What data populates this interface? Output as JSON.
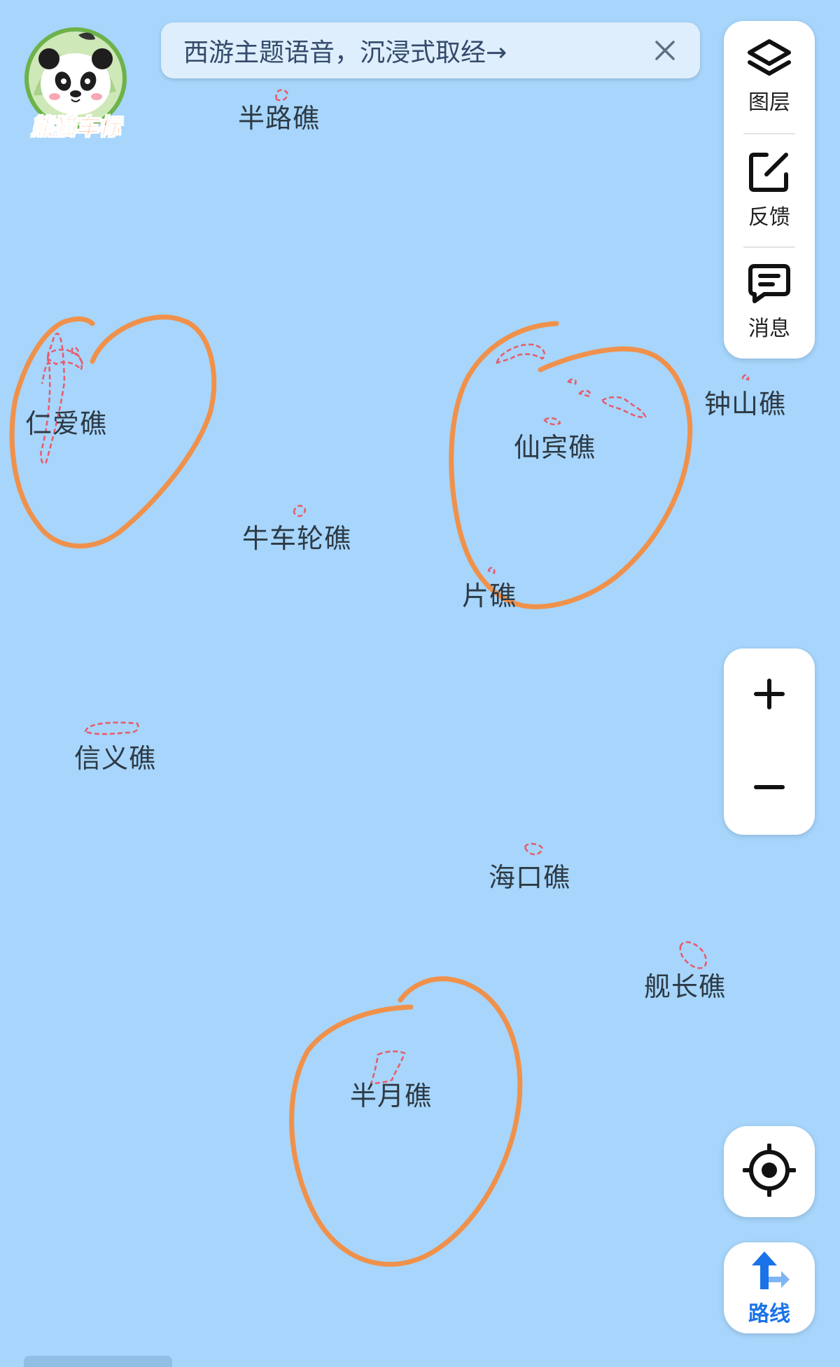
{
  "banner": {
    "text": "西游主题语音，沉浸式取经→"
  },
  "logo": {
    "text": "熊猫车标"
  },
  "toolbar": {
    "layers_label": "图层",
    "feedback_label": "反馈",
    "message_label": "消息"
  },
  "route": {
    "label": "路线"
  },
  "reefs": [
    {
      "name": "半路礁"
    },
    {
      "name": "仁爱礁"
    },
    {
      "name": "仙宾礁"
    },
    {
      "name": "钟山礁"
    },
    {
      "name": "牛车轮礁"
    },
    {
      "name": "片礁"
    },
    {
      "name": "信义礁"
    },
    {
      "name": "海口礁"
    },
    {
      "name": "舰长礁"
    },
    {
      "name": "半月礁"
    }
  ],
  "colors": {
    "water": "#a7d5fb",
    "reef_outline": "#e85a6a",
    "annotation": "#f0914b"
  },
  "icons": [
    "layers-icon",
    "feedback-edit-icon",
    "message-icon",
    "close-icon",
    "plus-icon",
    "minus-icon",
    "locate-icon",
    "route-arrow-icon"
  ]
}
